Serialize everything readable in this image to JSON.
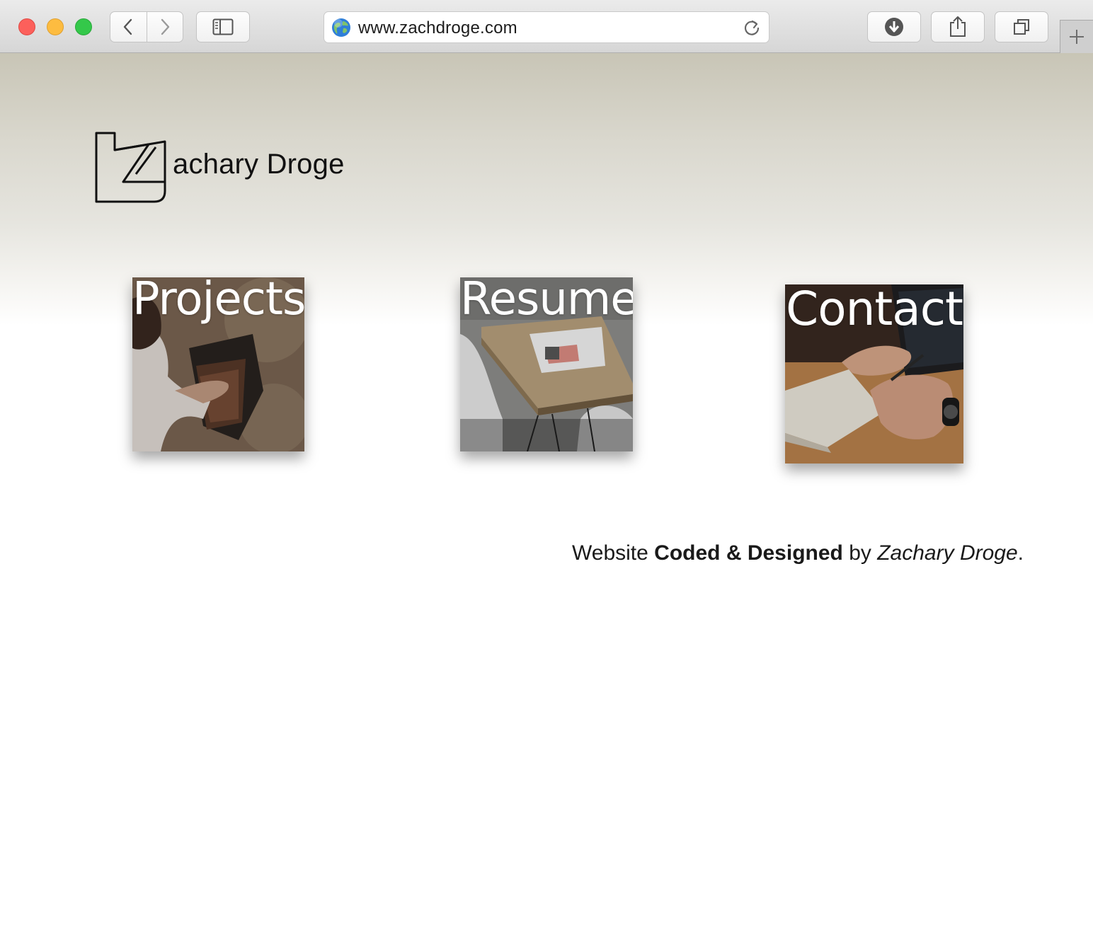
{
  "browser": {
    "url": "www.zachdroge.com"
  },
  "header": {
    "site_name": "achary Droge"
  },
  "tiles": [
    {
      "label": "Projects"
    },
    {
      "label": "Resume"
    },
    {
      "label": "Contact"
    }
  ],
  "footer": {
    "prefix": "Website ",
    "bold": "Coded & Designed",
    "middle": " by ",
    "italic": "Zachary Droge",
    "suffix": "."
  }
}
